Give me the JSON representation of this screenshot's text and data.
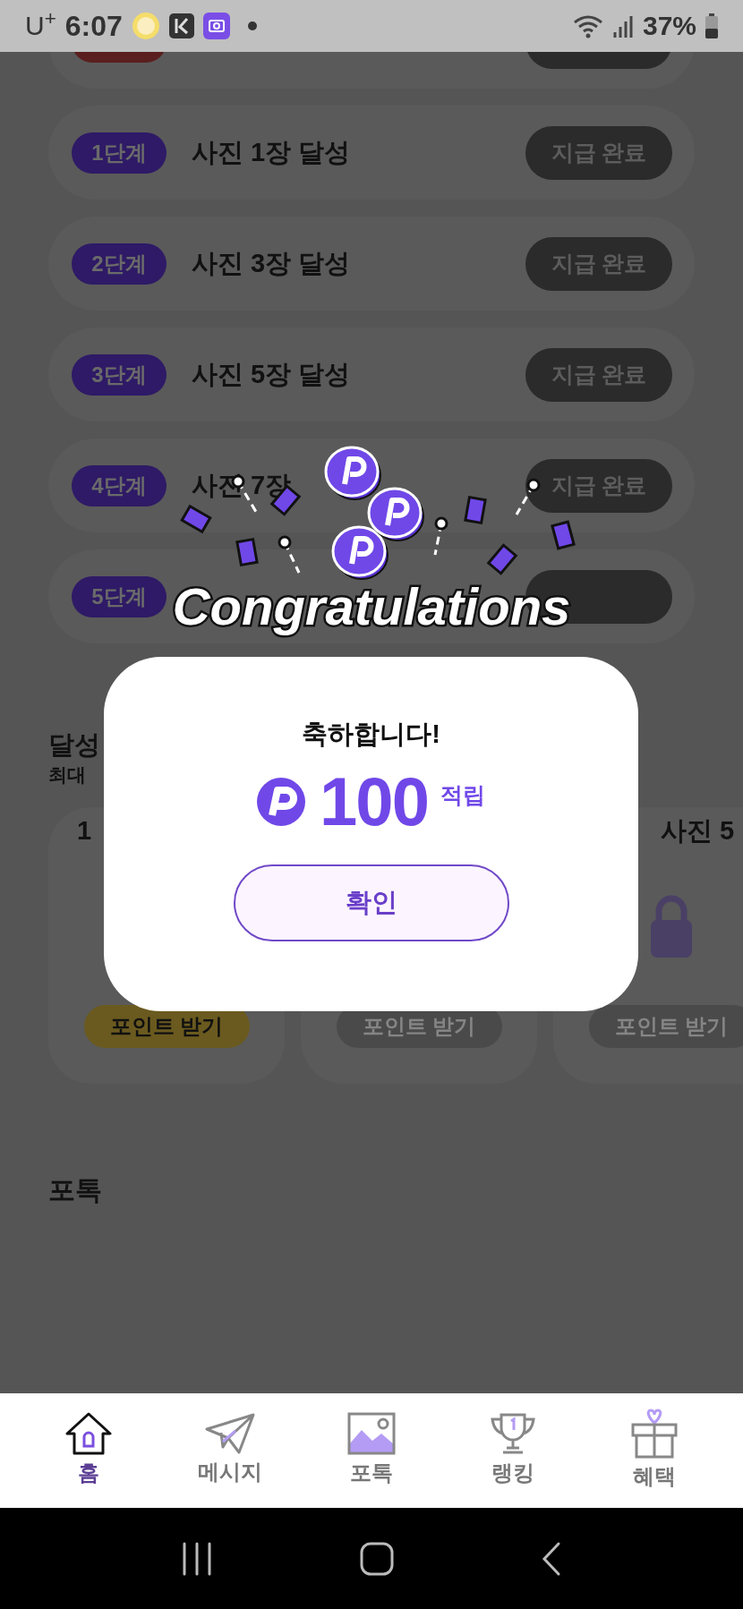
{
  "status_bar": {
    "carrier": "U$^{+}$",
    "time": "6:07",
    "battery": "37%"
  },
  "missions": [
    {
      "color": "#5a1f1f"
    },
    {
      "step": "1단계",
      "title": "사진 1장 달성",
      "button": "지급 완료",
      "color": "#2e1a66"
    },
    {
      "step": "2단계",
      "title": "사진 3장 달성",
      "button": "지급 완료",
      "color": "#2e1a66"
    },
    {
      "step": "3단계",
      "title": "사진 5장 달성",
      "button": "지급 완료",
      "color": "#2e1a66"
    },
    {
      "step": "4단계",
      "title": "사진 7장",
      "button": "지급 완료",
      "color": "#2e1a66"
    },
    {
      "step": "5단계",
      "color": "#2e1a66"
    }
  ],
  "achievement": {
    "title": "달성",
    "subtitle": "최대",
    "cards": [
      {
        "title": "1",
        "button": "포인트 받기",
        "active": true
      },
      {
        "button": "포인트 받기",
        "active": false
      },
      {
        "title": "사진 5",
        "button": "포인트 받기",
        "active": false,
        "locked": true
      }
    ]
  },
  "photok": {
    "title": "포톡"
  },
  "celebration": {
    "banner": "Congratulations"
  },
  "dialog": {
    "title": "축하합니다!",
    "amount": "100",
    "unit": "적립",
    "button": "확인"
  },
  "tab_bar": [
    {
      "kind": "home",
      "label": "홈",
      "selected": true
    },
    {
      "kind": "message",
      "label": "메시지",
      "selected": false
    },
    {
      "kind": "photo",
      "label": "포톡",
      "selected": false
    },
    {
      "kind": "ranking",
      "label": "랭킹",
      "selected": false
    },
    {
      "kind": "benefit",
      "label": "혜택",
      "selected": false
    }
  ]
}
